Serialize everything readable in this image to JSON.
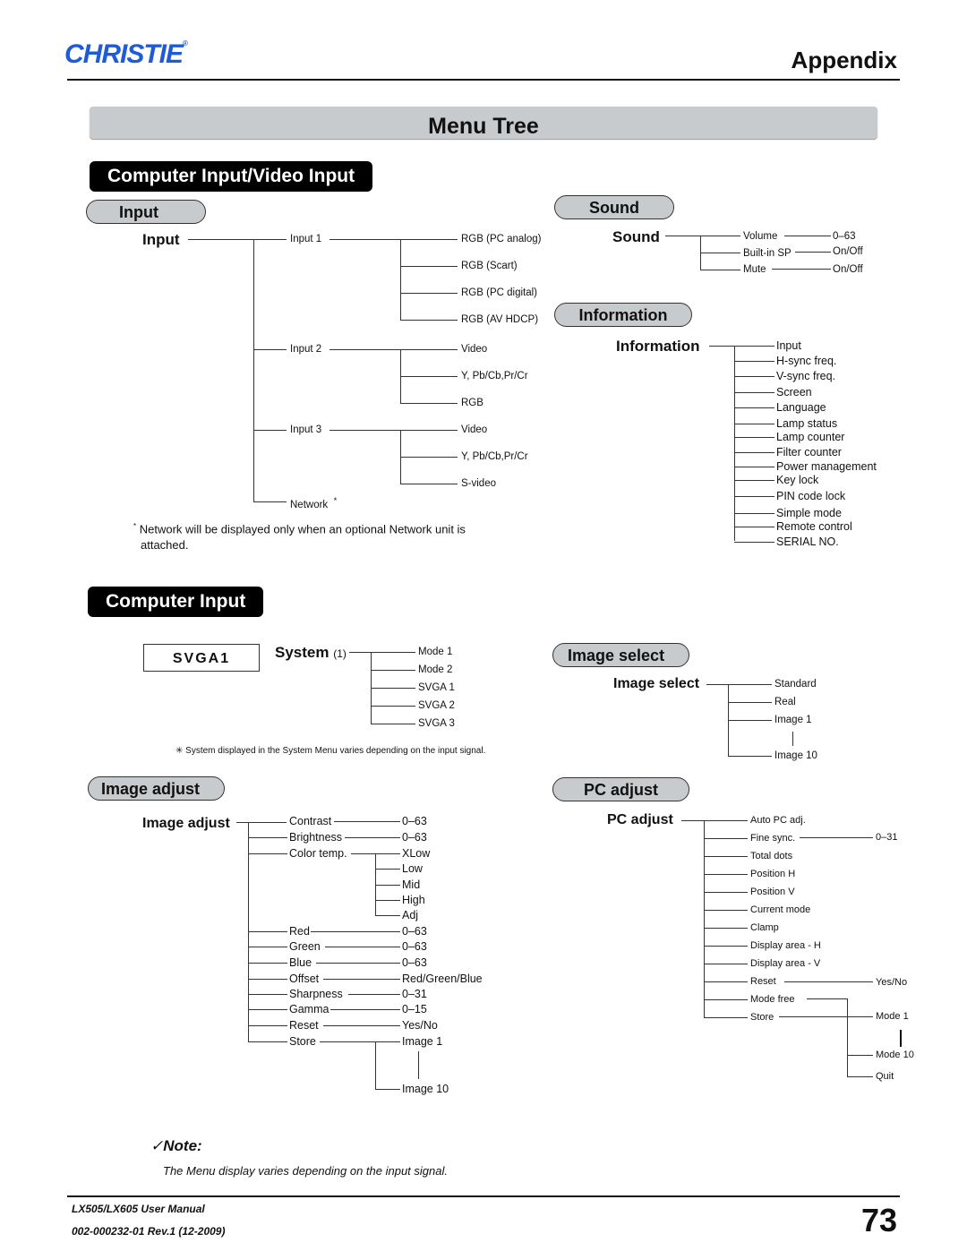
{
  "header": {
    "logo": "CHRISTIE",
    "logo_mark": "®",
    "section": "Appendix"
  },
  "banner": {
    "title": "Menu Tree"
  },
  "sections": {
    "computer_video_input": "Computer Input/Video Input",
    "computer_input": "Computer Input"
  },
  "input_menu": {
    "pill": "Input",
    "root": "Input",
    "input1": {
      "label": "Input 1",
      "items": [
        "RGB (PC analog)",
        "RGB (Scart)",
        "RGB (PC digital)",
        "RGB (AV HDCP)"
      ]
    },
    "input2": {
      "label": "Input 2",
      "items": [
        "Video",
        "Y, Pb/Cb,Pr/Cr",
        "RGB"
      ]
    },
    "input3": {
      "label": "Input 3",
      "items": [
        "Video",
        "Y, Pb/Cb,Pr/Cr",
        "S-video"
      ]
    },
    "network": {
      "label": "Network",
      "mark": "*"
    },
    "footnote_mark": "*",
    "footnote_line1": "Network will be displayed only when an optional Network unit is",
    "footnote_line2": "attached."
  },
  "sound_menu": {
    "pill": "Sound",
    "root": "Sound",
    "items": [
      {
        "label": "Volume",
        "value": "0–63"
      },
      {
        "label": "Built-in SP",
        "value": "On/Off"
      },
      {
        "label": "Mute",
        "value": "On/Off"
      }
    ]
  },
  "information_menu": {
    "pill": "Information",
    "root": "Information",
    "items": [
      "Input",
      "H-sync freq.",
      "V-sync freq.",
      "Screen",
      "Language",
      "Lamp status",
      "Lamp counter",
      "Filter counter",
      "Power management",
      "Key lock",
      "PIN code lock",
      "Simple mode",
      "Remote control",
      "SERIAL NO."
    ]
  },
  "system_menu": {
    "box": "SVGA1",
    "root": "System",
    "root_note": "(1)",
    "items": [
      "Mode 1",
      "Mode 2",
      "SVGA 1",
      "SVGA 2",
      "SVGA 3"
    ],
    "footnote": "✳ System displayed in the System Menu varies depending on the input signal."
  },
  "image_select_menu": {
    "pill": "Image select",
    "root": "Image select",
    "items": [
      "Standard",
      "Real",
      "Image 1",
      "Image 10"
    ]
  },
  "image_adjust_menu": {
    "pill": "Image adjust",
    "root": "Image adjust",
    "items": [
      {
        "label": "Contrast",
        "value": "0–63"
      },
      {
        "label": "Brightness",
        "value": "0–63"
      },
      {
        "label": "Color temp.",
        "values": [
          "XLow",
          "Low",
          "Mid",
          "High",
          "Adj"
        ]
      },
      {
        "label": "Red",
        "value": "0–63"
      },
      {
        "label": "Green",
        "value": "0–63"
      },
      {
        "label": "Blue",
        "value": "0–63"
      },
      {
        "label": "Offset",
        "value": "Red/Green/Blue"
      },
      {
        "label": "Sharpness",
        "value": "0–31"
      },
      {
        "label": "Gamma",
        "value": "0–15"
      },
      {
        "label": "Reset",
        "value": "Yes/No"
      },
      {
        "label": "Store",
        "values": [
          "Image 1",
          "Image 10"
        ]
      }
    ]
  },
  "pc_adjust_menu": {
    "pill": "PC adjust",
    "root": "PC adjust",
    "items": [
      {
        "label": "Auto PC adj."
      },
      {
        "label": "Fine sync.",
        "value": "0–31"
      },
      {
        "label": "Total dots"
      },
      {
        "label": "Position H"
      },
      {
        "label": "Position V"
      },
      {
        "label": "Current mode"
      },
      {
        "label": "Clamp"
      },
      {
        "label": "Display area - H"
      },
      {
        "label": "Display area - V"
      },
      {
        "label": "Reset",
        "value": "Yes/No"
      },
      {
        "label": "Mode free"
      },
      {
        "label": "Store"
      }
    ],
    "mode_values": [
      "Mode 1",
      "Mode 10",
      "Quit"
    ]
  },
  "note": {
    "icon": "✓",
    "title": "Note:",
    "text": "The Menu display varies depending on the input signal."
  },
  "footer": {
    "manual": "LX505/LX605 User Manual",
    "doc_id": "002-000232-01 Rev.1 (12-2009)",
    "page": "73"
  }
}
